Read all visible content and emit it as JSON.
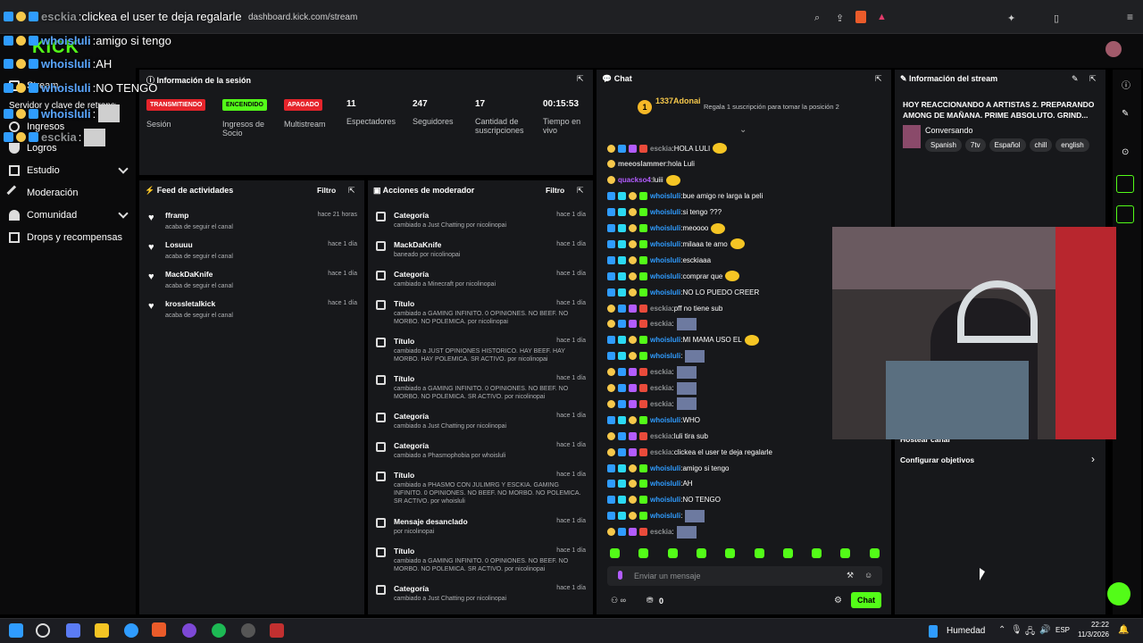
{
  "browser": {
    "url": "dashboard.kick.com/stream",
    "overlay_title": "clickea el user te deja regalarle"
  },
  "app": {
    "logo": "KICK"
  },
  "sidebar": {
    "items": [
      {
        "label": "Stream",
        "icon": "video-icon"
      },
      {
        "label": "Servidor y clave de retransmisión",
        "icon": "server-icon"
      },
      {
        "label": "Ingresos",
        "icon": "coins-icon"
      },
      {
        "label": "Logros",
        "icon": "trophy-icon"
      },
      {
        "label": "Estudio",
        "icon": "studio-icon",
        "chevron": true
      },
      {
        "label": "Moderación",
        "icon": "wrench-icon"
      },
      {
        "label": "Comunidad",
        "icon": "people-icon",
        "chevron": true
      },
      {
        "label": "Drops y recompensas",
        "icon": "gift-icon"
      }
    ]
  },
  "session": {
    "title": "Información de la sesión",
    "status": [
      {
        "pill": "TRANSMITIENDO",
        "label": "Sesión",
        "color": "#e5242b"
      },
      {
        "pill": "ENCENDIDO",
        "label": "Ingresos de Socio",
        "color": "#53fc18"
      },
      {
        "pill": "APAGADO",
        "label": "Multistream",
        "color": "#e5242b"
      }
    ],
    "stats": [
      {
        "value": "11",
        "label": "Espectadores"
      },
      {
        "value": "247",
        "label": "Seguidores"
      },
      {
        "value": "17",
        "label": "Cantidad de suscripciones"
      },
      {
        "value": "00:15:53",
        "label": "Tiempo en vivo"
      }
    ]
  },
  "feed": {
    "title": "Feed de actividades",
    "filter": "Filtro",
    "items": [
      {
        "name": "fframp",
        "sub": "acaba de seguir el canal",
        "time": "hace 21 horas"
      },
      {
        "name": "Losuuu",
        "sub": "acaba de seguir el canal",
        "time": "hace 1 día"
      },
      {
        "name": "MackDaKnife",
        "sub": "acaba de seguir el canal",
        "time": "hace 1 día"
      },
      {
        "name": "krossletalkick",
        "sub": "acaba de seguir el canal",
        "time": "hace 1 día"
      }
    ]
  },
  "mod": {
    "title": "Acciones de moderador",
    "filter": "Filtro",
    "items": [
      {
        "title": "Categoría",
        "sub": "cambiado a Just Chatting por nicolinopai",
        "time": "hace 1 día"
      },
      {
        "title": "MackDaKnife",
        "sub": "baneado por nicolinopai",
        "time": "hace 1 día"
      },
      {
        "title": "Categoría",
        "sub": "cambiado a Minecraft por nicolinopai",
        "time": "hace 1 día"
      },
      {
        "title": "Título",
        "sub": "cambiado a GAMING INFINITO. 0 OPINIONES. NO BEEF. NO MORBO. NO POLEMICA. por nicolinopai",
        "time": "hace 1 día"
      },
      {
        "title": "Título",
        "sub": "cambiado a JUST OPINIONES HISTORICO. HAY BEEF. HAY MORBO. HAY POLEMICA. SR ACTIVO. por nicolinopai",
        "time": "hace 1 día"
      },
      {
        "title": "Título",
        "sub": "cambiado a GAMING INFINITO. 0 OPINIONES. NO BEEF. NO MORBO. NO POLEMICA. SR ACTIVO. por nicolinopai",
        "time": "hace 1 día"
      },
      {
        "title": "Categoría",
        "sub": "cambiado a Just Chatting por nicolinopai",
        "time": "hace 1 día"
      },
      {
        "title": "Categoría",
        "sub": "cambiado a Phasmophobia por whoisluli",
        "time": "hace 1 día"
      },
      {
        "title": "Título",
        "sub": "cambiado a PHASMO CON JULIMRG Y ESCKIA. GAMING INFINITO. 0 OPINIONES. NO BEEF. NO MORBO. NO POLEMICA. SR ACTIVO. por whoisluli",
        "time": "hace 1 día"
      },
      {
        "title": "Mensaje desanclado",
        "sub": "por nicolinopai",
        "time": "hace 1 día"
      },
      {
        "title": "Título",
        "sub": "cambiado a GAMING INFINITO. 0 OPINIONES. NO BEEF. NO MORBO. NO POLEMICA. SR ACTIVO. por nicolinopai",
        "time": "hace 1 día"
      },
      {
        "title": "Categoría",
        "sub": "cambiado a Just Chatting por nicolinopai",
        "time": "hace 1 día"
      }
    ]
  },
  "chat": {
    "title": "Chat",
    "top_user": "1337Adonai",
    "top_rank": "1",
    "gift_hint": "Regala 1 suscripción para tomar la posición 2",
    "messages": [
      {
        "user": "esckia",
        "text": "HOLA LULI",
        "color": "#8d9092"
      },
      {
        "user": "meeoslammer",
        "text": "hola Luli",
        "color": "#d0d0d0"
      },
      {
        "user": "quackso4",
        "text": "luiii",
        "color": "#b35cff"
      },
      {
        "user": "whoisluli",
        "text": "bue amigo re larga la peli",
        "color": "#2f9cff"
      },
      {
        "user": "whoisluli",
        "text": "si tengo ???",
        "color": "#2f9cff"
      },
      {
        "user": "whoisluli",
        "text": "meoooo",
        "color": "#2f9cff"
      },
      {
        "user": "whoisluli",
        "text": "milaaa te amo",
        "color": "#2f9cff"
      },
      {
        "user": "whoisluli",
        "text": "esckiaaa",
        "color": "#2f9cff"
      },
      {
        "user": "whoisluli",
        "text": "comprar que",
        "color": "#2f9cff"
      },
      {
        "user": "whoisluli",
        "text": "NO LO PUEDO CREER",
        "color": "#2f9cff"
      },
      {
        "user": "esckia",
        "text": "pff no tiene sub",
        "color": "#8d9092"
      },
      {
        "user": "esckia",
        "text": "",
        "color": "#8d9092"
      },
      {
        "user": "whoisluli",
        "text": "MI MAMA USO EL",
        "color": "#2f9cff"
      },
      {
        "user": "whoisluli",
        "text": "",
        "color": "#2f9cff"
      },
      {
        "user": "esckia",
        "text": "",
        "color": "#8d9092"
      },
      {
        "user": "esckia",
        "text": "",
        "color": "#8d9092"
      },
      {
        "user": "esckia",
        "text": "",
        "color": "#8d9092"
      },
      {
        "user": "whoisluli",
        "text": "WHO",
        "color": "#2f9cff"
      },
      {
        "user": "esckia",
        "text": "luli tira sub",
        "color": "#8d9092"
      },
      {
        "user": "esckia",
        "text": "clickea el user te deja regalarle",
        "color": "#8d9092"
      },
      {
        "user": "whoisluli",
        "text": "amigo si tengo",
        "color": "#2f9cff"
      },
      {
        "user": "whoisluli",
        "text": "AH",
        "color": "#2f9cff"
      },
      {
        "user": "whoisluli",
        "text": "NO TENGO",
        "color": "#2f9cff"
      },
      {
        "user": "whoisluli",
        "text": "",
        "color": "#2f9cff"
      },
      {
        "user": "esckia",
        "text": "",
        "color": "#8d9092"
      }
    ],
    "input_placeholder": "Enviar un mensaje",
    "points": "0",
    "send_label": "Chat"
  },
  "stream_info": {
    "title": "Información del stream",
    "stream_title": "HOY REACCIONANDO A ARTISTAS 2. PREPARANDO AMONG DE MAÑANA. PRIME ABSOLUTO. GRIND...",
    "category": "Conversando",
    "tags": [
      "Spanish",
      "7tv",
      "Español",
      "chill",
      "english"
    ],
    "host_label": "Hostear canal",
    "goals_label": "Configurar objetivos"
  },
  "overlay": [
    {
      "user": "esckia",
      "text": "clickea el user te deja regalarle"
    },
    {
      "user": "whoisluli",
      "text": "amigo si tengo"
    },
    {
      "user": "whoisluli",
      "text": "AH"
    },
    {
      "user": "whoisluli",
      "text": "NO TENGO"
    },
    {
      "user": "whoisluli",
      "text": ""
    },
    {
      "user": "esckia",
      "text": ""
    }
  ],
  "taskbar": {
    "weather": "Humedad",
    "lang": "ESP",
    "time": "22:22",
    "date": "11/3/2026"
  }
}
